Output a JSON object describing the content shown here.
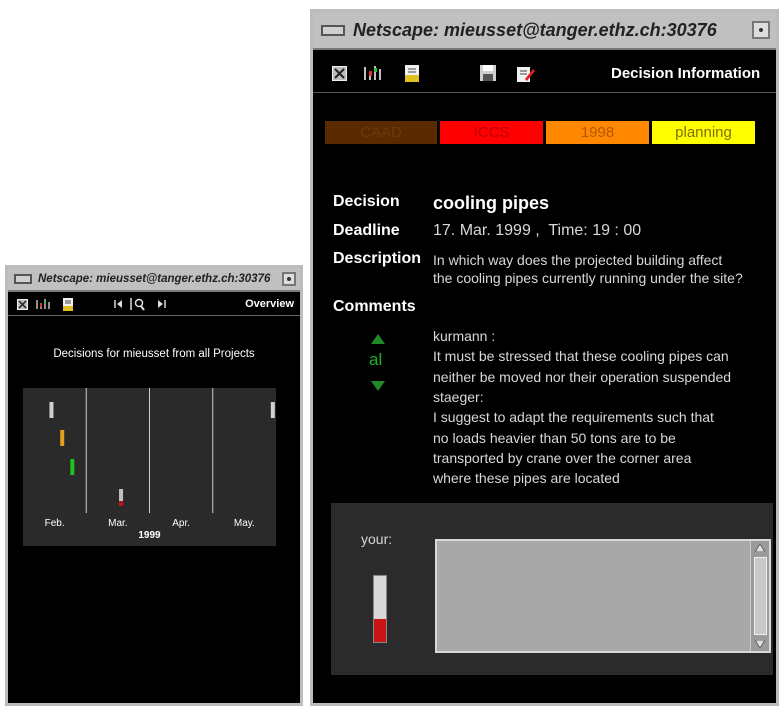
{
  "left_window": {
    "title": "Netscape: mieusset@tanger.ethz.ch:30376",
    "toolbar_label": "Overview",
    "heading": "Decisions for mieusset from all Projects",
    "chart_data": {
      "type": "timeline",
      "categories": [
        "Feb.",
        "Mar.",
        "Apr.",
        "May."
      ],
      "xlabel": "1999",
      "marks": [
        {
          "color": "#d0d0d0",
          "month_index": 0.45,
          "row": 0
        },
        {
          "color": "#e0a020",
          "month_index": 0.62,
          "row": 1
        },
        {
          "color": "#20c020",
          "month_index": 0.78,
          "row": 2
        },
        {
          "color": "#c0c0c0",
          "month_index": 1.55,
          "row": 3,
          "base_color": "#c01010"
        },
        {
          "color": "#d0d0d0",
          "month_index": 3.95,
          "row": 0
        }
      ]
    }
  },
  "right_window": {
    "title": "Netscape: mieusset@tanger.ethz.ch:30376",
    "toolbar_label": "Decision Information",
    "tags": [
      {
        "label": "CAAD",
        "bg": "#5a2a00",
        "fg": "#6a3a10"
      },
      {
        "label": "ICCS",
        "bg": "#ff0000",
        "fg": "#c00000"
      },
      {
        "label": "1998",
        "bg": "#ff8800",
        "fg": "#b05a00"
      },
      {
        "label": "planning",
        "bg": "#ffff00",
        "fg": "#807000"
      }
    ],
    "decision_label": "Decision",
    "decision_value": "cooling pipes",
    "deadline_label": "Deadline",
    "deadline_value": "17. Mar. 1999 ,  Time: 19 : 00",
    "description_label": "Description",
    "description_line1": "In which way does the projected building affect",
    "description_line2": "the cooling pipes currently running under the site?",
    "comments_label": "Comments",
    "vote_text": "al",
    "comments": [
      "kurmann :",
      "It must be stressed that these cooling pipes can",
      "neither be moved nor their operation suspended",
      "staeger:",
      "I suggest to adapt the requirements such that",
      "no loads heavier than 50 tons are to be",
      "transported by crane over the corner area",
      "where these pipes are located"
    ],
    "your_label": "your:",
    "your_level": 0.35,
    "comment_input_value": ""
  }
}
